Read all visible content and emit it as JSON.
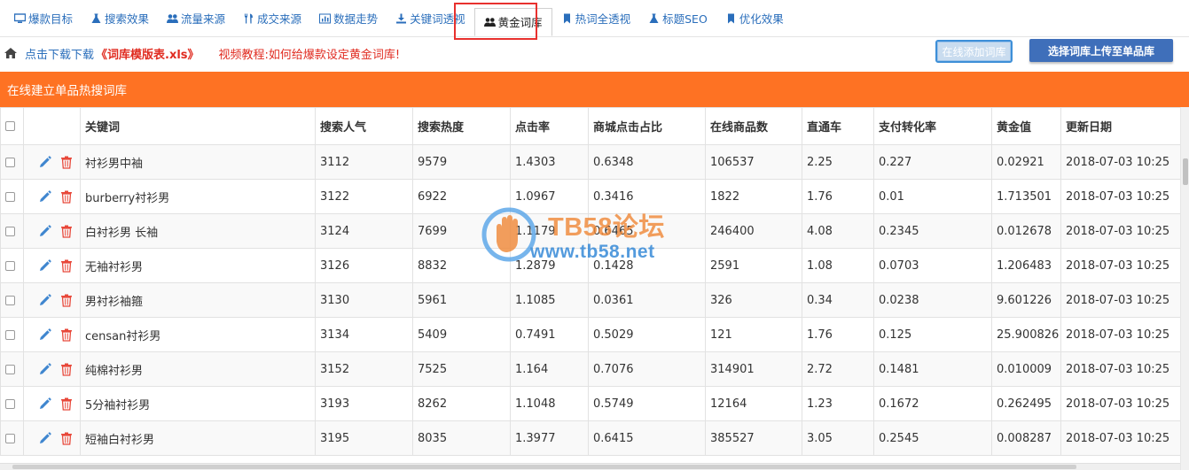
{
  "tabs": [
    {
      "label": "爆款目标",
      "icon": "monitor-icon"
    },
    {
      "label": "搜索效果",
      "icon": "flask-icon"
    },
    {
      "label": "流量来源",
      "icon": "users-icon"
    },
    {
      "label": "成交来源",
      "icon": "cutlery-icon"
    },
    {
      "label": "数据走势",
      "icon": "bar-chart-icon"
    },
    {
      "label": "关键词透视",
      "icon": "download-icon"
    },
    {
      "label": "黄金词库",
      "icon": "users-icon",
      "active": true
    },
    {
      "label": "热词全透视",
      "icon": "bookmark-icon"
    },
    {
      "label": "标题SEO",
      "icon": "flask-icon"
    },
    {
      "label": "优化效果",
      "icon": "bookmark-icon"
    }
  ],
  "linkbar": {
    "download_prefix": "点击下载下载",
    "file_name": "《词库模版表.xls》",
    "video_tutorial": "视频教程:如何给爆款设定黄金词库!",
    "add_online_button": "在线添加词库",
    "upload_button": "选择词库上传至单品库"
  },
  "panel": {
    "title": "在线建立单品热搜词库"
  },
  "table": {
    "columns": [
      "关键词",
      "搜索人气",
      "搜索热度",
      "点击率",
      "商城点击占比",
      "在线商品数",
      "直通车",
      "支付转化率",
      "黄金值",
      "更新日期"
    ],
    "rows": [
      [
        "衬衫男中袖",
        "3112",
        "9579",
        "1.4303",
        "0.6348",
        "106537",
        "2.25",
        "0.227",
        "0.02921",
        "2018-07-03 10:25"
      ],
      [
        "burberry衬衫男",
        "3122",
        "6922",
        "1.0967",
        "0.3416",
        "1822",
        "1.76",
        "0.01",
        "1.713501",
        "2018-07-03 10:25"
      ],
      [
        "白衬衫男 长袖",
        "3124",
        "7699",
        "1.1179",
        "0.6465",
        "246400",
        "4.08",
        "0.2345",
        "0.012678",
        "2018-07-03 10:25"
      ],
      [
        "无袖衬衫男",
        "3126",
        "8832",
        "1.2879",
        "0.1428",
        "2591",
        "1.08",
        "0.0703",
        "1.206483",
        "2018-07-03 10:25"
      ],
      [
        "男衬衫袖箍",
        "3130",
        "5961",
        "1.1085",
        "0.0361",
        "326",
        "0.34",
        "0.0238",
        "9.601226",
        "2018-07-03 10:25"
      ],
      [
        "censan衬衫男",
        "3134",
        "5409",
        "0.7491",
        "0.5029",
        "121",
        "1.76",
        "0.125",
        "25.900826",
        "2018-07-03 10:25"
      ],
      [
        "纯棉衬衫男",
        "3152",
        "7525",
        "1.164",
        "0.7076",
        "314901",
        "2.72",
        "0.1481",
        "0.010009",
        "2018-07-03 10:25"
      ],
      [
        "5分袖衬衫男",
        "3193",
        "8262",
        "1.1048",
        "0.5749",
        "12164",
        "1.23",
        "0.1672",
        "0.262495",
        "2018-07-03 10:25"
      ],
      [
        "短袖白衬衫男",
        "3195",
        "8035",
        "1.3977",
        "0.6415",
        "385527",
        "3.05",
        "0.2545",
        "0.008287",
        "2018-07-03 10:25"
      ]
    ]
  },
  "watermark": {
    "title": "TB58论坛",
    "url": "www.tb58.net"
  },
  "colors": {
    "accent_orange": "#fe7223",
    "link_blue": "#2a6ebb",
    "red": "#e02b20",
    "button_blue": "#3f6fba"
  }
}
